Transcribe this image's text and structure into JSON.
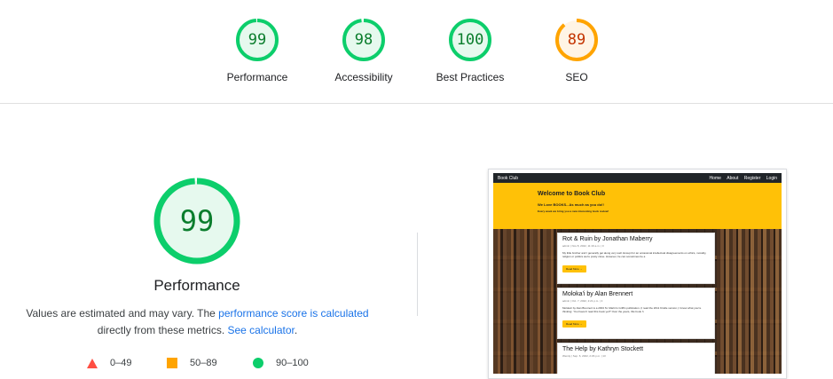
{
  "summary": [
    {
      "score": "99",
      "label": "Performance",
      "color": "#0cce6b",
      "fill": "#e6f9ee",
      "text": "#0a7d2c",
      "fraction": 0.99
    },
    {
      "score": "98",
      "label": "Accessibility",
      "color": "#0cce6b",
      "fill": "#e6f9ee",
      "text": "#0a7d2c",
      "fraction": 0.98
    },
    {
      "score": "100",
      "label": "Best Practices",
      "color": "#0cce6b",
      "fill": "#e6f9ee",
      "text": "#0a7d2c",
      "fraction": 1.0
    },
    {
      "score": "89",
      "label": "SEO",
      "color": "#ffa400",
      "fill": "#fff4e5",
      "text": "#c33300",
      "fraction": 0.89
    }
  ],
  "main": {
    "score": "99",
    "fraction": 0.99,
    "title": "Performance",
    "desc_pre": "Values are estimated and may vary. The ",
    "desc_link1": "performance score is calculated",
    "desc_mid": "directly from these metrics. ",
    "desc_link2": "See calculator",
    "desc_post": "."
  },
  "legend": {
    "fail": "0–49",
    "average": "50–89",
    "pass": "90–100",
    "fail_color": "#ff4e42",
    "average_color": "#ffa400",
    "pass_color": "#0cce6b"
  },
  "screenshot": {
    "brand": "Book Club",
    "nav": [
      "Home",
      "About",
      "Register",
      "Login"
    ],
    "hero_title": "Welcome to Book Club",
    "hero_sub": "We Love BOOKS...As much as you do!!",
    "hero_sub2": "Every week we bring you a new interesting book review!",
    "posts": [
      {
        "title": "Rot & Ruin by Jonathan Maberry",
        "meta": "admin | Nov 8, 2022, 11:19 a.m. | 0",
        "body": "My little brother and I generally get along very well. Except for an occasional intellectual disagreements on ethics, morality, religion or politics we're pretty close. However, he can sometimes be a",
        "btn": "Read More →"
      },
      {
        "title": "Moloka'i by Alan Brennert",
        "meta": "admin | Oct. 7, 2022, 2:21 p.m. | 4",
        "body": "Moloka'i by Alan Brennert is a 2004 St. Martin's Griffin publication. (I read the 2011 Kindle version.) I know what you're thinking: 'You haven't read this book yet?' Over the years, this book h",
        "btn": "Read More →"
      },
      {
        "title": "The Help by Kathryn Stockett",
        "meta": "Wendy | Sep. 6, 2022, 2:29 p.m. | 13",
        "body": "",
        "btn": ""
      }
    ]
  }
}
